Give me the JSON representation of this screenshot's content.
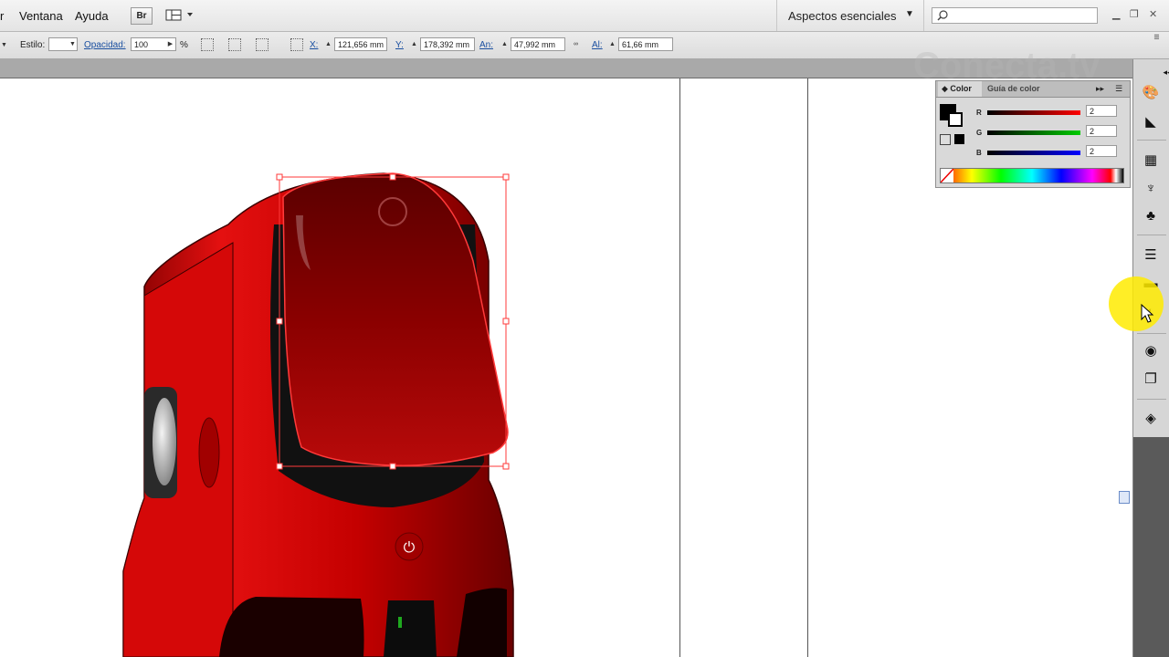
{
  "menubar": {
    "items": [
      "r",
      "Ventana",
      "Ayuda"
    ],
    "bridge_label": "Br",
    "workspace": "Aspectos esenciales",
    "search_placeholder": ""
  },
  "control_bar": {
    "style_label": "Estilo:",
    "opacity_label": "Opacidad:",
    "opacity_value": "100",
    "opacity_unit": "%",
    "x_label": "X:",
    "x_value": "121,656 mm",
    "y_label": "Y:",
    "y_value": "178,392 mm",
    "width_label": "An:",
    "width_value": "47,992 mm",
    "height_label": "Al:",
    "height_value": "61,66 mm"
  },
  "color_panel": {
    "tab_color": "Color",
    "tab_guide": "Guía de color",
    "r_label": "R",
    "r_value": "2",
    "g_label": "G",
    "g_value": "2",
    "b_label": "B",
    "b_value": "2",
    "fill_color": "#020202"
  },
  "watermark": "Conecta.tv",
  "colors": {
    "product_red": "#c40000",
    "selection": "#ff3a3a",
    "highlight": "#ffeb00"
  }
}
